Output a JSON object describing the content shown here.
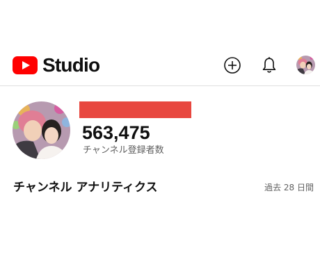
{
  "app": {
    "logo_text": "Studio",
    "logo_icon": "youtube-play-icon"
  },
  "header": {
    "create_icon": "plus-circle-icon",
    "notifications_icon": "bell-icon",
    "account_avatar": "avatar"
  },
  "channel": {
    "subscriber_count": "563,475",
    "subscriber_label": "チャンネル登録者数",
    "redaction_color": "#e8473f"
  },
  "analytics": {
    "title": "チャンネル アナリティクス",
    "period": "過去 28 日間"
  },
  "colors": {
    "brand_red": "#ff0000",
    "text_primary": "#0f0f0f",
    "text_secondary": "#606060",
    "divider": "#e0e0e0"
  }
}
